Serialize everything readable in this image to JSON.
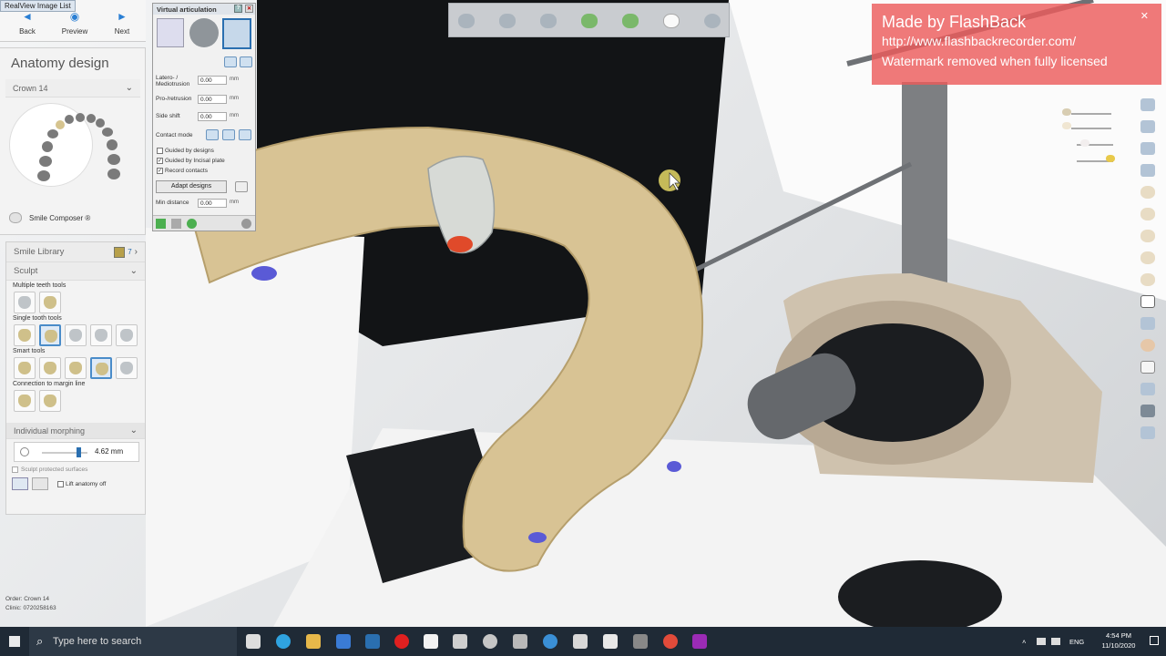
{
  "app": {
    "realview_tab": "RealView Image List",
    "nav": {
      "back": "Back",
      "preview": "Preview",
      "next": "Next"
    }
  },
  "left": {
    "title": "Anatomy design",
    "section1": "Crown 14",
    "smile_composer": "Smile Composer ®",
    "smile_library": "Smile Library",
    "smile_library_badge": "7",
    "sculpt": "Sculpt",
    "multiple_teeth_tools": "Multiple teeth tools",
    "single_tooth_tools": "Single tooth tools",
    "smart_tools": "Smart tools",
    "connection_margin": "Connection to margin line",
    "individual_morphing": "Individual morphing",
    "morph_value": "4.62 mm",
    "sculpt_protected": "Sculpt protected surfaces",
    "lift_anatomy": "Lift anatomy off"
  },
  "virtual_articulation": {
    "title": "Virtual articulation",
    "latero_label": "Latero- / Mediotrusion",
    "latero_value": "0.00",
    "protrusion_label": "Pro-/retrusion",
    "protrusion_value": "0.00",
    "side_shift_label": "Side shift",
    "side_shift_value": "0.00",
    "unit": "mm",
    "contact_mode": "Contact mode",
    "guided_by_designs": "Guided by designs",
    "guided_by_incisal": "Guided by Incisal plate",
    "record_contacts": "Record contacts",
    "adapt_designs": "Adapt designs",
    "min_distance_label": "Min distance",
    "min_distance_value": "0.00"
  },
  "watermark": {
    "line1": "Made by FlashBack",
    "line2": "http://www.flashbackrecorder.com/",
    "line3": "Watermark removed when fully licensed"
  },
  "order_info": {
    "order": "Order:   Crown 14",
    "clinic": "Clinic:   0720258163"
  },
  "taskbar": {
    "search_placeholder": "Type here to search",
    "lang": "ENG",
    "time": "4:54 PM",
    "date": "11/10/2020"
  },
  "colors": {
    "accent": "#2a7fd4",
    "model": "#d8c394",
    "watermark": "#eb5c5c",
    "taskbar": "#1f2a36"
  }
}
